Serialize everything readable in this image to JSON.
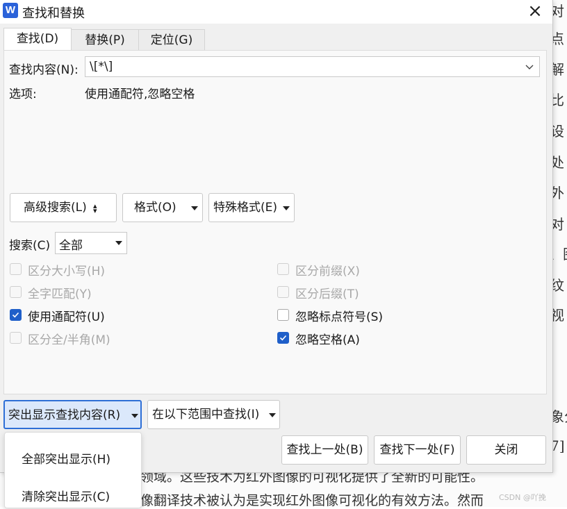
{
  "dialog": {
    "app_icon": "W",
    "title": "查找和替换",
    "close": "×"
  },
  "tabs": [
    {
      "label": "查找(D)",
      "active": true
    },
    {
      "label": "替换(P)",
      "active": false
    },
    {
      "label": "定位(G)",
      "active": false
    }
  ],
  "find": {
    "label": "查找内容(N):",
    "value": "\\[*\\]"
  },
  "options": {
    "label": "选项:",
    "value": "使用通配符,忽略空格"
  },
  "buttons": {
    "advanced": "高级搜索(L)",
    "format": "格式(O)",
    "special": "特殊格式(E)"
  },
  "search_scope": {
    "label": "搜索(C)",
    "selected": "全部"
  },
  "checkboxes_left": [
    {
      "label": "区分大小写(H)",
      "checked": false,
      "enabled": false
    },
    {
      "label": "全字匹配(Y)",
      "checked": false,
      "enabled": false
    },
    {
      "label": "使用通配符(U)",
      "checked": true,
      "enabled": true
    },
    {
      "label": "区分全/半角(M)",
      "checked": false,
      "enabled": false
    }
  ],
  "checkboxes_right": [
    {
      "label": "区分前缀(X)",
      "checked": false,
      "enabled": false
    },
    {
      "label": "区分后缀(T)",
      "checked": false,
      "enabled": false
    },
    {
      "label": "忽略标点符号(S)",
      "checked": false,
      "enabled": true
    },
    {
      "label": "忽略空格(A)",
      "checked": true,
      "enabled": true
    }
  ],
  "bottom": {
    "highlight": "突出显示查找内容(R)",
    "find_in": "在以下范围中查找(I)",
    "find_prev": "查找上一处(B)",
    "find_next": "查找下一处(F)",
    "close": "关闭"
  },
  "highlight_menu": [
    "全部突出显示(H)",
    "清除突出显示(C)"
  ],
  "background_doc": {
    "right_chars": [
      "对",
      "点",
      "解",
      "比",
      "设",
      "处",
      "外",
      "对",
      "、图",
      "纹",
      "视"
    ],
    "lower_right": [
      "象分",
      "7]",
      ""
    ],
    "line1": "领域。这些技术为红外图像的可视化提供了全新的可能性。",
    "line2": "像翻译技术被认为是实现红外图像可视化的有效方法。然而",
    "watermark": "CSDN @吖挽"
  },
  "colors": {
    "accent": "#1f5fc9",
    "app_icon": "#2b62d9"
  }
}
